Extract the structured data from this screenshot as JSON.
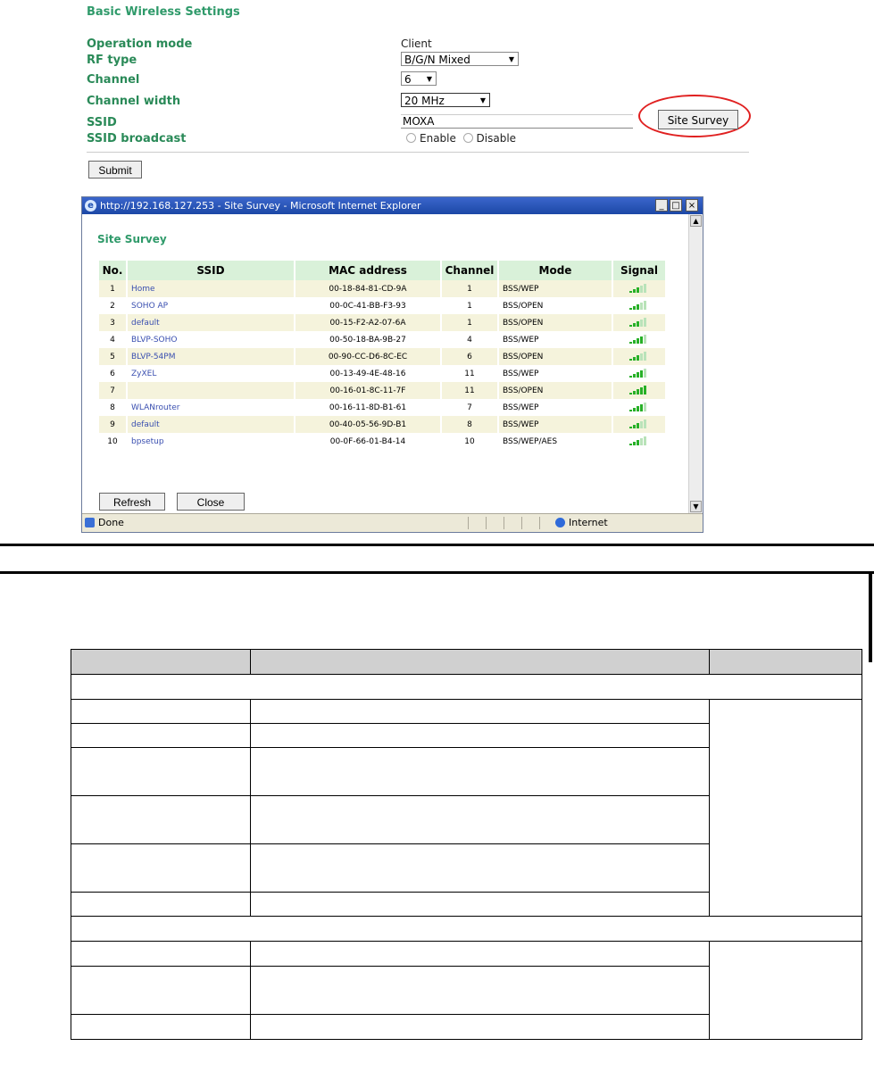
{
  "settings": {
    "title": "Basic Wireless Settings",
    "fields": [
      {
        "label": "Operation mode",
        "value": "Client"
      },
      {
        "label": "RF type",
        "value": "B/G/N Mixed"
      },
      {
        "label": "Channel",
        "value": "6"
      },
      {
        "label": "Channel width",
        "value": "20 MHz"
      },
      {
        "label": "SSID",
        "value": "MOXA"
      },
      {
        "label": "SSID broadcast",
        "options": [
          "Enable",
          "Disable"
        ]
      }
    ],
    "site_survey_label": "Site Survey",
    "submit_label": "Submit"
  },
  "popup": {
    "window_title": "http://192.168.127.253 - Site Survey - Microsoft Internet Explorer",
    "heading": "Site Survey",
    "columns": [
      "No.",
      "SSID",
      "MAC address",
      "Channel",
      "Mode",
      "Signal"
    ],
    "rows": [
      {
        "no": "1",
        "ssid": "Home",
        "mac": "00-18-84-81-CD-9A",
        "channel": "1",
        "mode": "BSS/WEP",
        "signal": 3
      },
      {
        "no": "2",
        "ssid": "SOHO AP",
        "mac": "00-0C-41-BB-F3-93",
        "channel": "1",
        "mode": "BSS/OPEN",
        "signal": 3
      },
      {
        "no": "3",
        "ssid": "default",
        "mac": "00-15-F2-A2-07-6A",
        "channel": "1",
        "mode": "BSS/OPEN",
        "signal": 3
      },
      {
        "no": "4",
        "ssid": "BLVP-SOHO",
        "mac": "00-50-18-BA-9B-27",
        "channel": "4",
        "mode": "BSS/WEP",
        "signal": 4
      },
      {
        "no": "5",
        "ssid": "BLVP-54PM",
        "mac": "00-90-CC-D6-8C-EC",
        "channel": "6",
        "mode": "BSS/OPEN",
        "signal": 3
      },
      {
        "no": "6",
        "ssid": "ZyXEL",
        "mac": "00-13-49-4E-48-16",
        "channel": "11",
        "mode": "BSS/WEP",
        "signal": 4
      },
      {
        "no": "7",
        "ssid": "",
        "mac": "00-16-01-8C-11-7F",
        "channel": "11",
        "mode": "BSS/OPEN",
        "signal": 5
      },
      {
        "no": "8",
        "ssid": "WLANrouter",
        "mac": "00-16-11-8D-B1-61",
        "channel": "7",
        "mode": "BSS/WEP",
        "signal": 4
      },
      {
        "no": "9",
        "ssid": "default",
        "mac": "00-40-05-56-9D-B1",
        "channel": "8",
        "mode": "BSS/WEP",
        "signal": 3
      },
      {
        "no": "10",
        "ssid": "bpsetup",
        "mac": "00-0F-66-01-B4-14",
        "channel": "10",
        "mode": "BSS/WEP/AES",
        "signal": 3
      }
    ],
    "refresh_label": "Refresh",
    "close_label": "Close",
    "status_left": "Done",
    "status_zone": "Internet"
  }
}
